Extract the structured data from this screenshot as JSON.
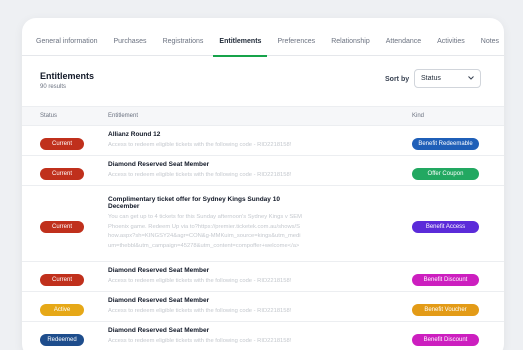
{
  "tabs": [
    {
      "label": "General information",
      "active": false
    },
    {
      "label": "Purchases",
      "active": false
    },
    {
      "label": "Registrations",
      "active": false
    },
    {
      "label": "Entitlements",
      "active": true
    },
    {
      "label": "Preferences",
      "active": false
    },
    {
      "label": "Relationship",
      "active": false
    },
    {
      "label": "Attendance",
      "active": false
    },
    {
      "label": "Activities",
      "active": false
    },
    {
      "label": "Notes",
      "active": false
    }
  ],
  "header": {
    "title": "Entitlements",
    "subtitle": "90 results",
    "sort_label": "Sort by",
    "sort_value": "Status"
  },
  "columns": {
    "status": "Status",
    "entitlement": "Entitlement",
    "kind": "Kind"
  },
  "colors": {
    "current": "#c0301c",
    "active": "#e6a817",
    "redeemed": "#1e4d8c",
    "benefit_redeemable": "#1f5fb8",
    "offer_coupon": "#22a861",
    "benefit_access": "#5b2bd9",
    "benefit_discount": "#cc1fbf",
    "benefit_voucher": "#e39b17",
    "accent": "#16a34a"
  },
  "rows": [
    {
      "status": "Current",
      "status_color": "#c0301c",
      "title": "Allianz Round 12",
      "desc": "Access to redeem eligible tickets with the following code - RID2218158!",
      "kind": "Benefit Redeemable",
      "kind_color": "#1f5fb8"
    },
    {
      "status": "Current",
      "status_color": "#c0301c",
      "title": "Diamond Reserved Seat Member",
      "desc": "Access to redeem eligible tickets with the following code - RID2218158!",
      "kind": "Offer Coupon",
      "kind_color": "#22a861"
    },
    {
      "status": "Current",
      "status_color": "#c0301c",
      "title": "Complimentary ticket offer for Sydney Kings Sunday 10 December",
      "desc": "You can get up to 4 tickets for this Sunday afternoon's Sydney Kings v SEM Phoenix game. Redeem Up via to?https://premier.ticketek.com.au/shows/Show.aspx?sh=KINGSY24&agr=CON&g-MMKuim_source=kings&utm_medium=thebbl&utm_campaign=45278&utm_content=compoffer+welcome</a>",
      "kind": "Benefit Access",
      "kind_color": "#5b2bd9"
    },
    {
      "status": "Current",
      "status_color": "#c0301c",
      "title": "Diamond Reserved Seat Member",
      "desc": "Access to redeem eligible tickets with the following code - RID2218158!",
      "kind": "Benefit Discount",
      "kind_color": "#cc1fbf"
    },
    {
      "status": "Active",
      "status_color": "#e6a817",
      "title": "Diamond Reserved Seat Member",
      "desc": "Access to redeem eligible tickets with the following code - RID2218158!",
      "kind": "Benefit Voucher",
      "kind_color": "#e39b17"
    },
    {
      "status": "Redeemed",
      "status_color": "#1e4d8c",
      "title": "Diamond Reserved Seat Member",
      "desc": "Access to redeem eligible tickets with the following code - RID2218158!",
      "kind": "Benefit Discount",
      "kind_color": "#cc1fbf"
    }
  ]
}
